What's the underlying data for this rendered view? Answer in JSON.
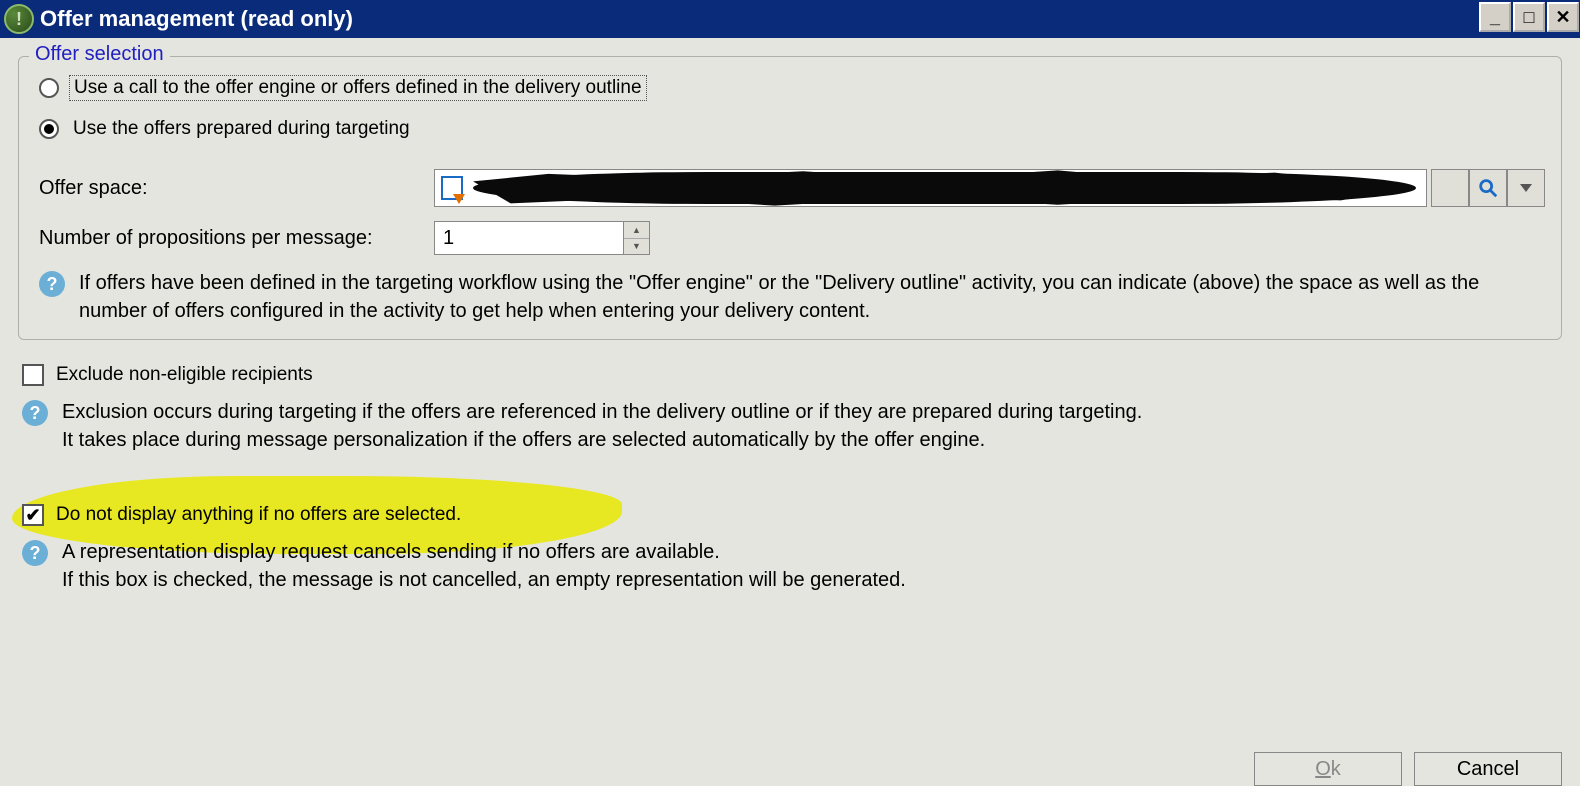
{
  "titlebar": {
    "title": "Offer management (read only)"
  },
  "fieldset": {
    "legend": "Offer selection",
    "radio1": "Use a call to the offer engine or offers defined in the delivery outline",
    "radio2": "Use the offers prepared during targeting",
    "offer_space_label": "Offer space:",
    "propositions_label": "Number of propositions per message:",
    "propositions_value": "1",
    "help1": "If offers have been defined in the targeting workflow using the \"Offer engine\" or the \"Delivery outline\" activity, you can indicate (above) the space as well as the number of offers configured in the activity to get help when entering your delivery content."
  },
  "exclude": {
    "label": "Exclude non-eligible recipients",
    "help": "Exclusion occurs during targeting if the offers are referenced in the delivery outline or if they are prepared during targeting.\nIt takes place during message personalization if the offers are selected automatically by the offer engine."
  },
  "nodisplay": {
    "label": "Do not display anything if no offers are selected.",
    "help": "A representation display request cancels sending if no offers are available.\nIf this box is checked, the message is not cancelled, an empty representation will be generated."
  },
  "buttons": {
    "ok": "Ok",
    "cancel": "Cancel"
  }
}
